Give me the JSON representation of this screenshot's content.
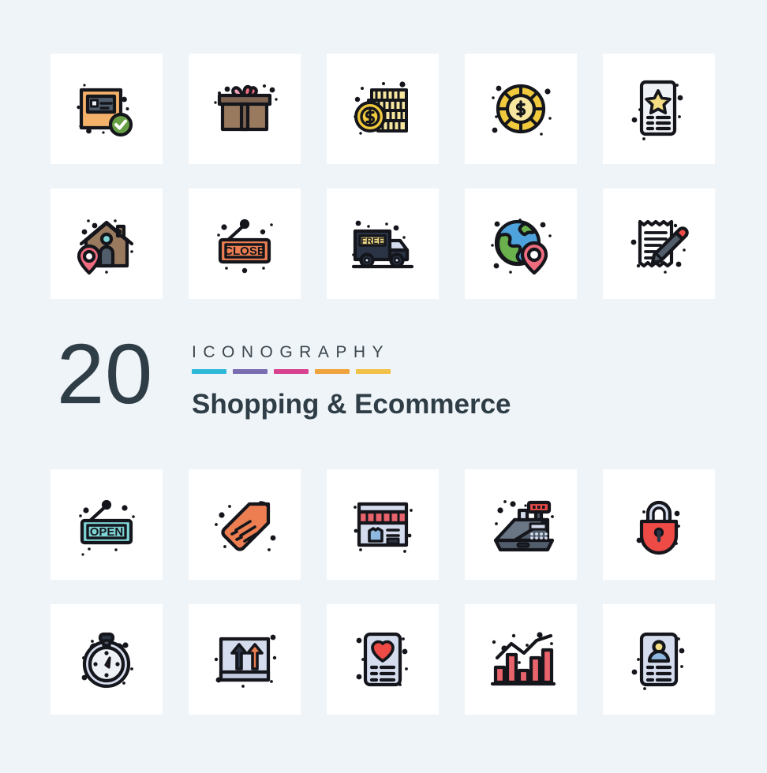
{
  "page": {
    "background_color": "#eff4f8",
    "card_color": "#ffffff"
  },
  "title_band": {
    "count": "20",
    "eyebrow": "ICONOGRAPHY",
    "subtitle": "Shopping & Ecommerce",
    "text_color": "#2f3d46",
    "accent_bars": [
      {
        "name": "bar-cyan",
        "color": "#2fb8d8"
      },
      {
        "name": "bar-purple",
        "color": "#7a6cb0"
      },
      {
        "name": "bar-pink",
        "color": "#d8418f"
      },
      {
        "name": "bar-orange",
        "color": "#f0a33c"
      },
      {
        "name": "bar-yellow",
        "color": "#f2c14a"
      }
    ]
  },
  "palette": {
    "outline": "#14161c",
    "orange": "#f5b169",
    "green": "#67a044",
    "brown": "#9a7a5f",
    "brown_dark": "#7d6350",
    "pink": "#ef6c7f",
    "pink_light": "#f2a0b8",
    "yellow": "#f5dd84",
    "gold": "#f0c93c",
    "gold_light": "#f7e6a0",
    "slate": "#2b3445",
    "slate_light": "#d5dced",
    "red": "#ee4a46",
    "red_soft": "#e8636b",
    "teal": "#7fd4d6",
    "orange_tag": "#ec7e51",
    "blue": "#8fb8e0",
    "blue_deep": "#4ea3dc",
    "green_globe": "#6ab04c",
    "paper": "#eef1f6",
    "grey_dark": "#525d6b"
  },
  "icon_grid": {
    "columns": 5,
    "rows": [
      {
        "name": "row-1",
        "icons": [
          {
            "id": "package-verified",
            "label": "Verified Package"
          },
          {
            "id": "gift-box",
            "label": "Gift Box"
          },
          {
            "id": "coin-stack",
            "label": "Coin Stack"
          },
          {
            "id": "dollar-coin",
            "label": "Dollar Coin"
          },
          {
            "id": "wishlist-star",
            "label": "Star Rated List"
          }
        ]
      },
      {
        "name": "row-2",
        "icons": [
          {
            "id": "home-location",
            "label": "Home Location"
          },
          {
            "id": "close-sign",
            "label": "Close Sign"
          },
          {
            "id": "free-delivery-truck",
            "label": "Free Delivery Truck"
          },
          {
            "id": "global-location",
            "label": "Global Location"
          },
          {
            "id": "receipt-edit",
            "label": "Receipt With Pencil"
          }
        ]
      },
      {
        "name": "row-3",
        "icons": [
          {
            "id": "open-sign",
            "label": "Open Sign"
          },
          {
            "id": "price-tag",
            "label": "Price Tag"
          },
          {
            "id": "shop-storefront",
            "label": "Shop Storefront"
          },
          {
            "id": "cash-register",
            "label": "Cash Register"
          },
          {
            "id": "padlock-secure",
            "label": "Secure Padlock"
          }
        ]
      },
      {
        "name": "row-4",
        "icons": [
          {
            "id": "stopwatch",
            "label": "Stopwatch"
          },
          {
            "id": "this-side-up-box",
            "label": "This Side Up Box"
          },
          {
            "id": "wishlist-heart",
            "label": "Wishlist"
          },
          {
            "id": "growth-bar-chart",
            "label": "Sales Growth Chart"
          },
          {
            "id": "user-profile-card",
            "label": "User Profile"
          }
        ]
      }
    ]
  }
}
